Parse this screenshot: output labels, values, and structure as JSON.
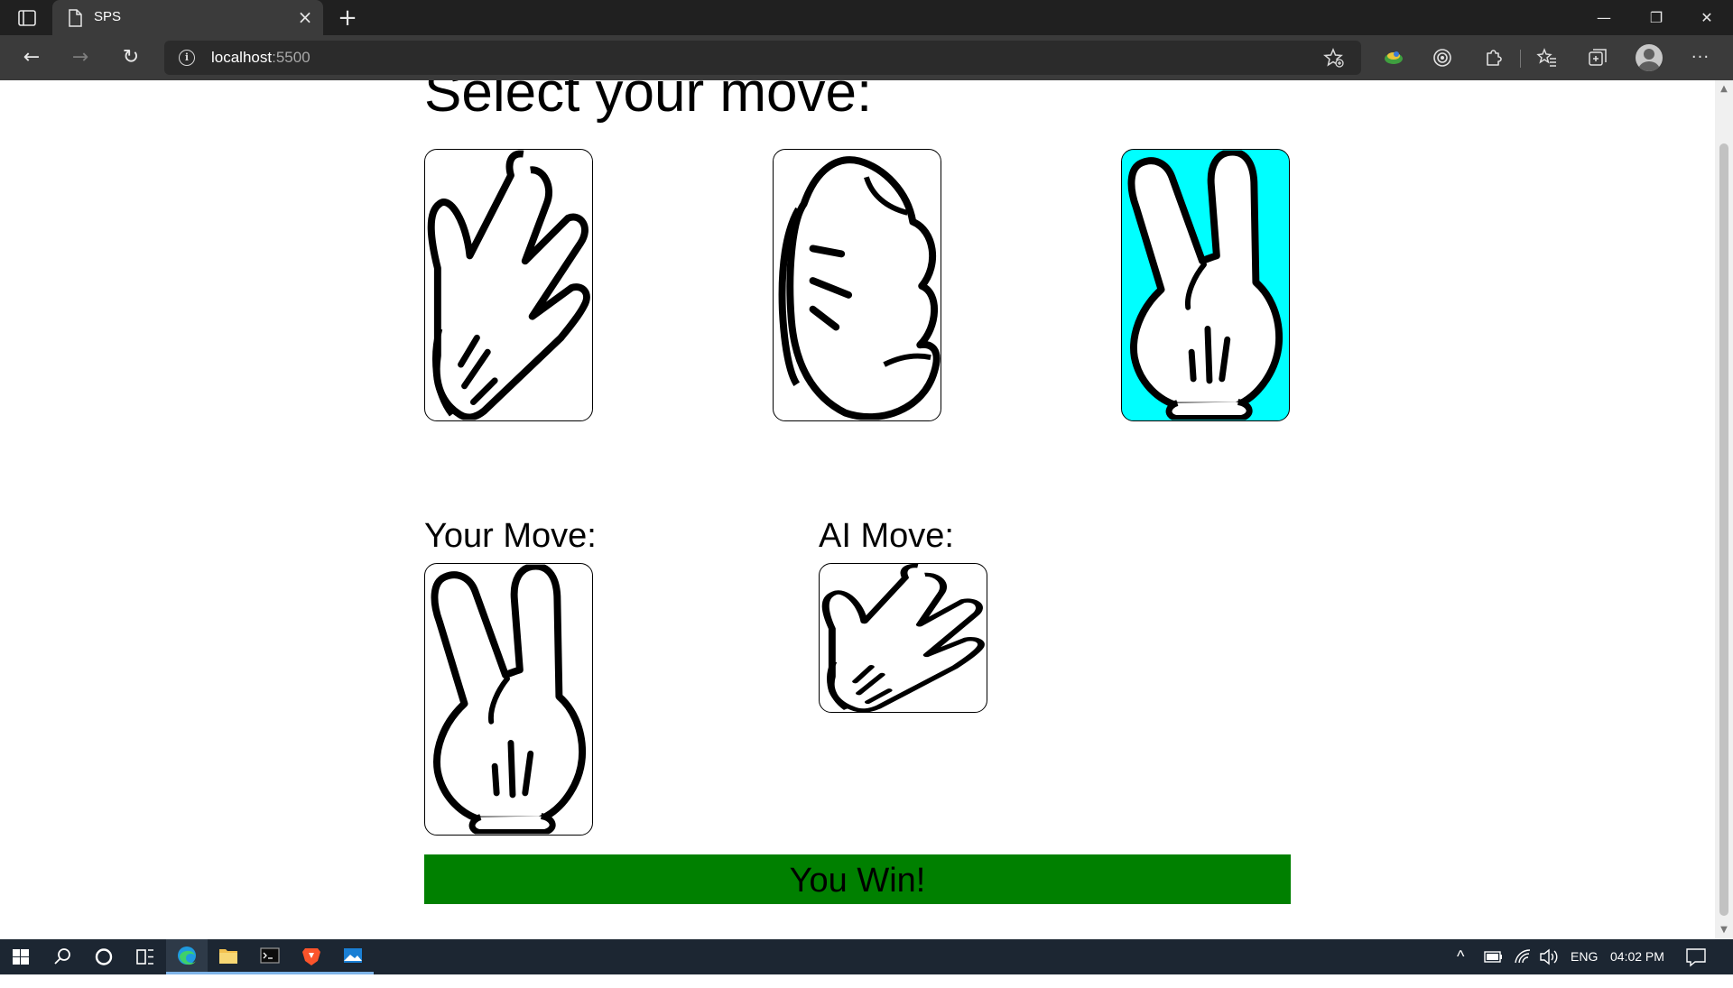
{
  "browser": {
    "tab": {
      "title": "SPS",
      "close": "×"
    },
    "new_tab": "+",
    "window_controls": {
      "minimize": "—",
      "restore": "❐",
      "close": "✕"
    },
    "nav": {
      "back": "←",
      "forward": "→",
      "refresh": "↻"
    },
    "address": {
      "host": "localhost",
      "port": ":5500"
    },
    "icons": [
      "favorites-add-icon",
      "extension-colored-icon",
      "tracking-icon",
      "extensions-icon",
      "favorites-icon",
      "collections-icon",
      "profile-icon",
      "more-icon"
    ],
    "more": "···"
  },
  "game": {
    "heading": "Select your move:",
    "options": [
      {
        "name": "scissors",
        "selected": false,
        "icon": "peace-hand-tilted-icon"
      },
      {
        "name": "rock",
        "selected": false,
        "icon": "fist-icon"
      },
      {
        "name": "paper",
        "selected": true,
        "icon": "peace-hand-icon"
      }
    ],
    "selected_color": "#00ffff",
    "your_move_label": "Your Move:",
    "ai_move_label": "AI Move:",
    "your_move_icon": "peace-hand-icon",
    "ai_move_icon": "peace-hand-tilted-icon",
    "result": {
      "text": "You Win!",
      "color": "#008000"
    }
  },
  "taskbar": {
    "apps": [
      "windows-start-icon",
      "search-icon",
      "cortana-icon",
      "task-view-icon",
      "edge-icon",
      "file-explorer-icon",
      "terminal-icon",
      "brave-icon",
      "photos-icon"
    ],
    "tray": {
      "chevron": "^",
      "language": "ENG",
      "time": "04:02 PM"
    }
  }
}
